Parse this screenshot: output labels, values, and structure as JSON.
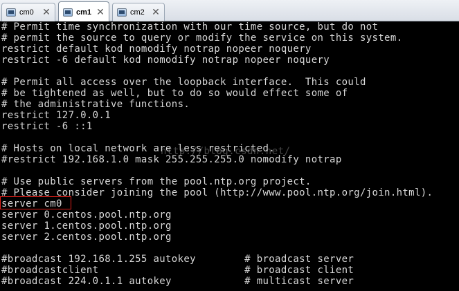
{
  "tabs": [
    {
      "label": "cm0",
      "active": false
    },
    {
      "label": "cm1",
      "active": true
    },
    {
      "label": "cm2",
      "active": false
    }
  ],
  "terminal": {
    "lines": [
      "# Permit time synchronization with our time source, but do not",
      "# permit the source to query or modify the service on this system.",
      "restrict default kod nomodify notrap nopeer noquery",
      "restrict -6 default kod nomodify notrap nopeer noquery",
      "",
      "# Permit all access over the loopback interface.  This could",
      "# be tightened as well, but to do so would effect some of",
      "# the administrative functions.",
      "restrict 127.0.0.1",
      "restrict -6 ::1",
      "",
      "# Hosts on local network are less restricted.",
      "#restrict 192.168.1.0 mask 255.255.255.0 nomodify notrap",
      "",
      "# Use public servers from the pool.ntp.org project.",
      "# Please consider joining the pool (http://www.pool.ntp.org/join.html).",
      "server cm0",
      "server 0.centos.pool.ntp.org",
      "server 1.centos.pool.ntp.org",
      "server 2.centos.pool.ntp.org",
      "",
      "#broadcast 192.168.1.255 autokey        # broadcast server",
      "#broadcastclient                        # broadcast client",
      "#broadcast 224.0.1.1 autokey            # multicast server"
    ],
    "highlighted_line": "server cm0",
    "watermark": "http://blog.csdn.net/",
    "text_color": "#d8d8d8",
    "background": "#000000",
    "highlight_color": "#e0201a"
  }
}
